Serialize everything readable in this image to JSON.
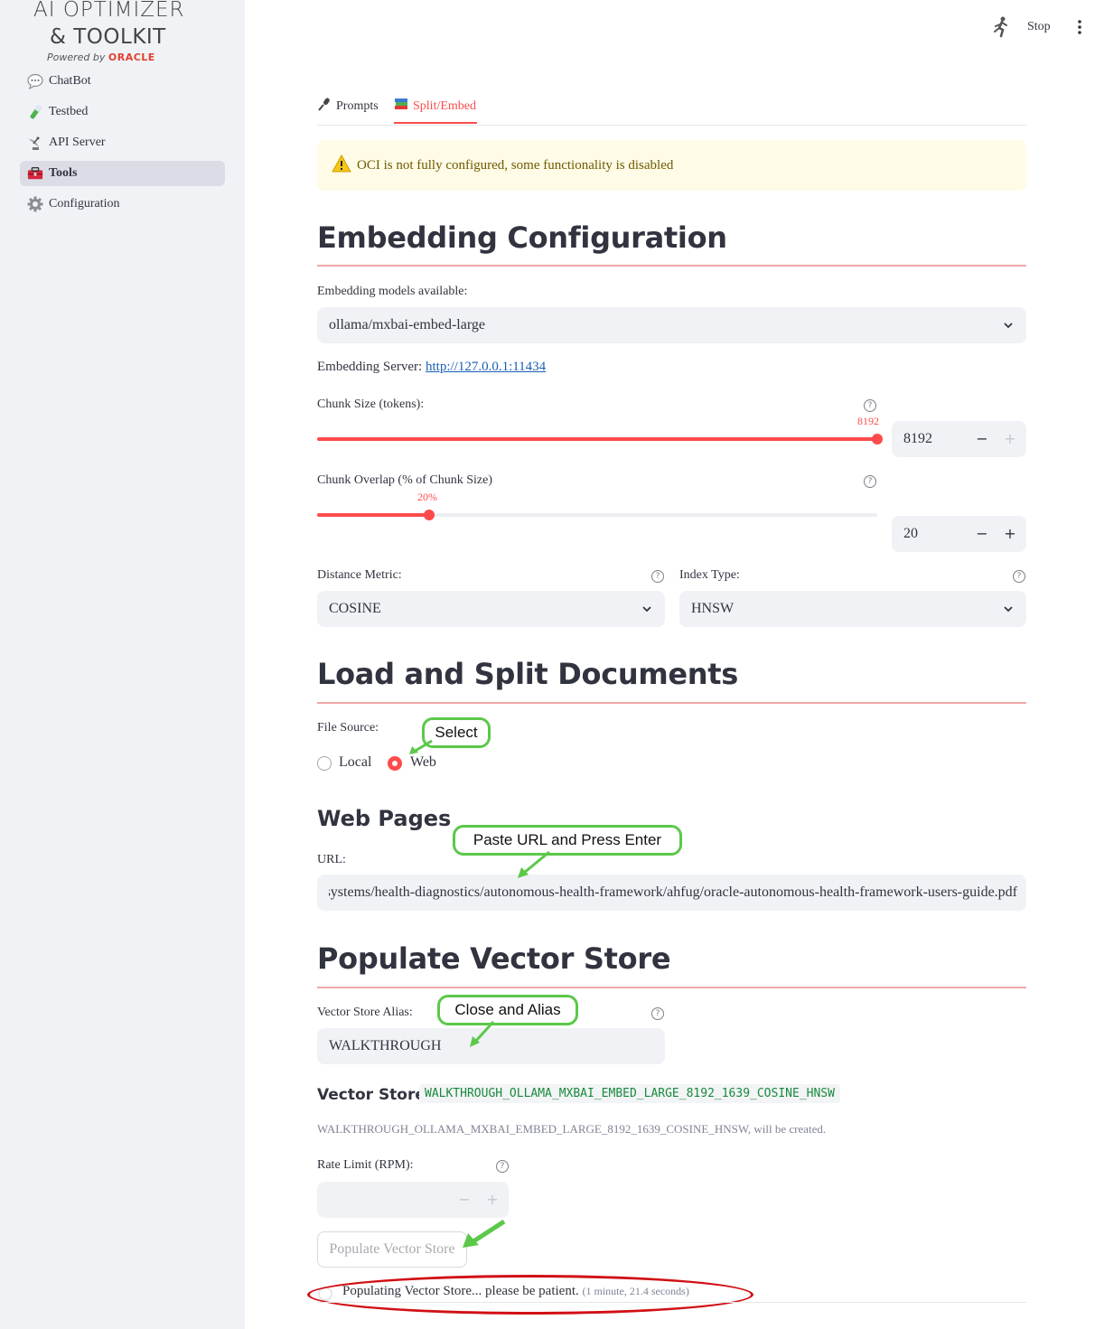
{
  "logo": {
    "line1": "AI OPTIMIZER",
    "line2": "& TOOLKIT",
    "powered_by": "Powered by",
    "oracle": "ORACLE"
  },
  "sidebar": {
    "items": [
      {
        "label": "ChatBot",
        "icon": "chat-bubble-icon"
      },
      {
        "label": "Testbed",
        "icon": "test-tube-icon"
      },
      {
        "label": "API Server",
        "icon": "satellite-dish-icon"
      },
      {
        "label": "Tools",
        "icon": "toolbox-icon",
        "active": true
      },
      {
        "label": "Configuration",
        "icon": "gear-icon"
      }
    ]
  },
  "topbar": {
    "stop_label": "Stop",
    "running_icon": "running-man-icon",
    "menu_icon": "kebab-menu-icon"
  },
  "tabs": [
    {
      "label": "Prompts",
      "icon": "microphone-icon"
    },
    {
      "label": "Split/Embed",
      "icon": "books-icon",
      "active": true
    }
  ],
  "alert": {
    "icon": "warning-icon",
    "text": "OCI is not fully configured, some functionality is disabled"
  },
  "embedding": {
    "title": "Embedding Configuration",
    "models_label": "Embedding models available:",
    "model_value": "ollama/mxbai-embed-large",
    "server_label": "Embedding Server:",
    "server_url": "http://127.0.0.1:11434",
    "chunk_size": {
      "label": "Chunk Size (tokens):",
      "slider_value": "8192",
      "input_value": "8192",
      "fraction": 1.0
    },
    "chunk_overlap": {
      "label": "Chunk Overlap (% of Chunk Size)",
      "slider_value": "20%",
      "input_value": "20",
      "fraction": 0.2
    },
    "distance_metric": {
      "label": "Distance Metric:",
      "value": "COSINE"
    },
    "index_type": {
      "label": "Index Type:",
      "value": "HNSW"
    }
  },
  "load_split": {
    "title": "Load and Split Documents",
    "file_source_label": "File Source:",
    "options": [
      {
        "label": "Local",
        "selected": false
      },
      {
        "label": "Web",
        "selected": true
      }
    ]
  },
  "web_pages": {
    "title": "Web Pages",
    "url_label": "URL:",
    "url_value": "systems/health-diagnostics/autonomous-health-framework/ahfug/oracle-autonomous-health-framework-users-guide.pdf"
  },
  "populate": {
    "title": "Populate Vector Store",
    "alias_label": "Vector Store Alias:",
    "alias_value": "WALKTHROUGH",
    "vector_store_label": "Vector Store:",
    "vector_store_name": "WALKTHROUGH_OLLAMA_MXBAI_EMBED_LARGE_8192_1639_COSINE_HNSW",
    "created_note": "WALKTHROUGH_OLLAMA_MXBAI_EMBED_LARGE_8192_1639_COSINE_HNSW, will be created.",
    "rate_limit_label": "Rate Limit (RPM):",
    "button_label": "Populate Vector Store",
    "status_text": "Populating Vector Store... please be patient.",
    "status_time": "(1 minute, 21.4 seconds)"
  },
  "annotations": {
    "select": "Select",
    "paste_url": "Paste URL and Press Enter",
    "close_alias": "Close and Alias"
  },
  "colors": {
    "accent": "#ff4b4b",
    "callout_border": "#5cc84a",
    "highlight_ring": "#d01015",
    "sidebar_bg": "#f0f2f6",
    "alert_bg": "#fffbe6"
  }
}
